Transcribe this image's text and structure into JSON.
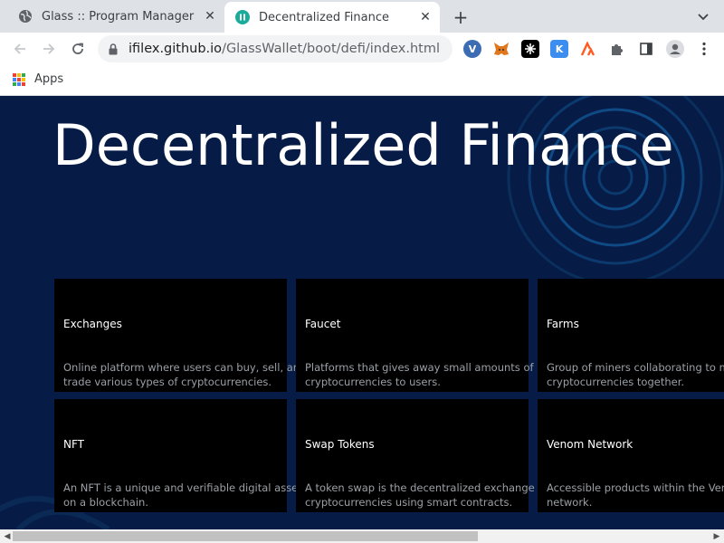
{
  "browser": {
    "tabs": [
      {
        "title": "Glass :: Program Manager",
        "icon": "globe-icon",
        "active": false
      },
      {
        "title": "Decentralized Finance",
        "icon": "site-favicon",
        "active": true
      }
    ],
    "new_tab_symbol": "+",
    "close_symbol": "✕",
    "url_host": "ifilex.github.io",
    "url_path": "/GlassWallet/boot/defi/index.html",
    "extensions": [
      "vivaldi-icon",
      "metamask-icon",
      "wallet-icon",
      "keplr-icon",
      "ai-icon",
      "puzzle-icon",
      "sidepanel-icon",
      "profile-icon",
      "menu-icon"
    ],
    "bookmarks": {
      "apps_label": "Apps"
    }
  },
  "page": {
    "heading": "Decentralized Finance",
    "cards": [
      {
        "title": "Exchanges",
        "desc_lines": [
          "Online platform where users can buy, sell, and",
          "trade various types of cryptocurrencies."
        ]
      },
      {
        "title": "Faucet",
        "desc_lines": [
          "Platforms that gives away small amounts of",
          "cryptocurrencies to users."
        ]
      },
      {
        "title": "Farms",
        "desc_lines": [
          "Group of miners collaborating to mine",
          "cryptocurrencies together."
        ]
      },
      {
        "title": "NFT",
        "desc_lines": [
          "An NFT is a unique and verifiable digital asset",
          "on a blockchain."
        ]
      },
      {
        "title": "Swap Tokens",
        "desc_lines": [
          "A token swap is the decentralized exchange of",
          "cryptocurrencies using smart contracts."
        ]
      },
      {
        "title": "Venom Network",
        "desc_lines": [
          "Accessible products within the Venom",
          "network."
        ]
      }
    ]
  },
  "colors": {
    "page_bg": "#061b45",
    "card_bg": "#000000",
    "card_desc": "#9aa0a6"
  }
}
